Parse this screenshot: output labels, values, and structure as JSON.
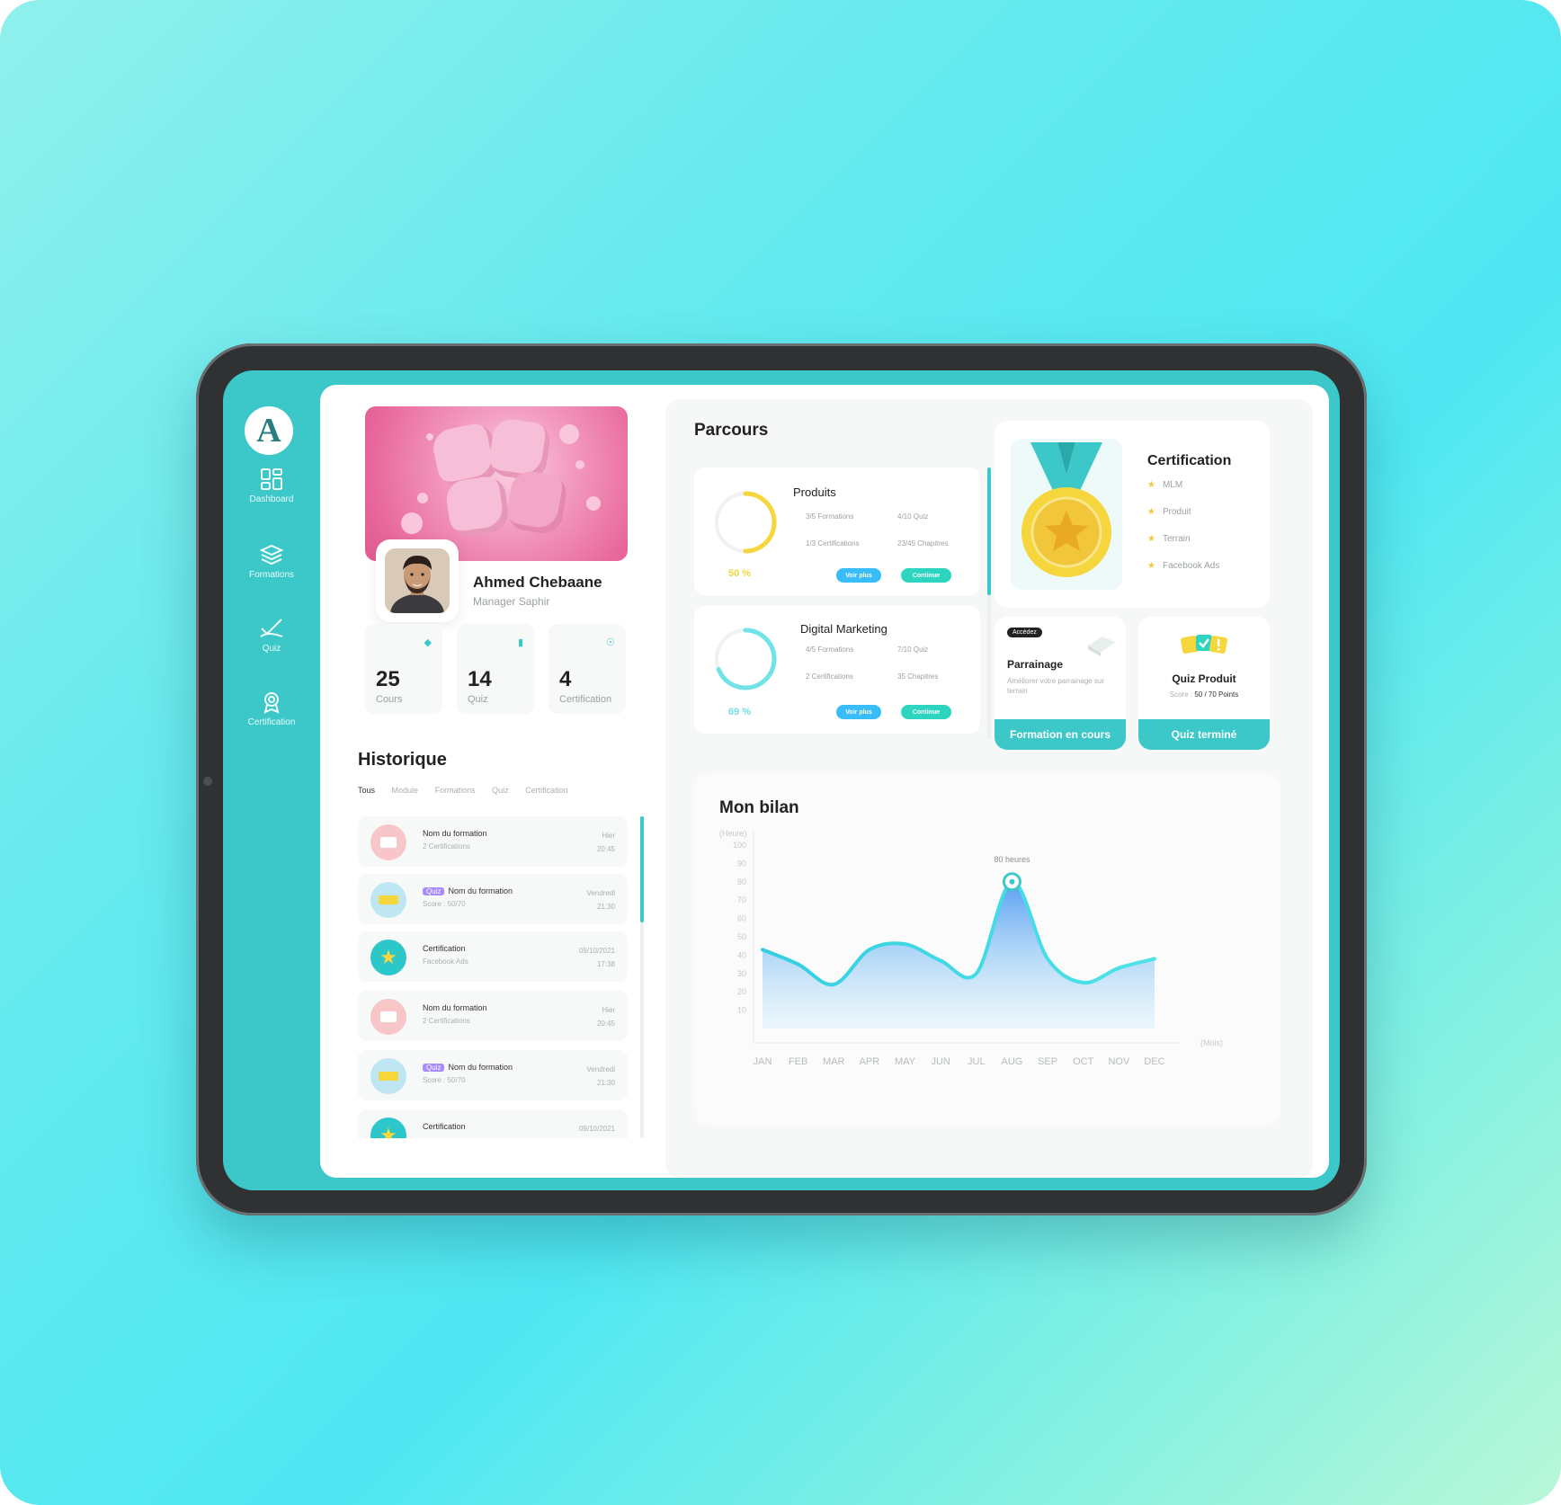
{
  "app": {
    "logo_letter": "A"
  },
  "sidebar": {
    "items": [
      {
        "label": "Dashboard",
        "icon": "dashboard-icon"
      },
      {
        "label": "Formations",
        "icon": "layers-icon"
      },
      {
        "label": "Quiz",
        "icon": "quiz-icon"
      },
      {
        "label": "Certification",
        "icon": "award-icon"
      }
    ]
  },
  "profile": {
    "name": "Ahmed Chebaane",
    "role": "Manager Saphir"
  },
  "stats": [
    {
      "value": "25",
      "label": "Cours",
      "icon": "book-icon"
    },
    {
      "value": "14",
      "label": "Quiz",
      "icon": "chat-icon"
    },
    {
      "value": "4",
      "label": "Certification",
      "icon": "award-icon"
    }
  ],
  "history": {
    "title": "Historique",
    "tabs": [
      "Tous",
      "Module",
      "Formations",
      "Quiz",
      "Certification"
    ],
    "items": [
      {
        "kind": "formation",
        "title": "Nom du formation",
        "sub": "2 Certifications",
        "date": "Hier",
        "time": "20:45"
      },
      {
        "kind": "quiz",
        "tag": "Quiz",
        "title": "Nom du formation",
        "sub": "Score : 50/70",
        "date": "Vendredi",
        "time": "21:30"
      },
      {
        "kind": "certification",
        "title": "Certification",
        "sub": "Facebook Ads",
        "date": "09/10/2021",
        "time": "17:38"
      },
      {
        "kind": "formation",
        "title": "Nom du formation",
        "sub": "2 Certifications",
        "date": "Hier",
        "time": "20:45"
      },
      {
        "kind": "quiz",
        "tag": "Quiz",
        "title": "Nom du formation",
        "sub": "Score : 50/70",
        "date": "Vendredi",
        "time": "21:30"
      },
      {
        "kind": "certification",
        "title": "Certification",
        "sub": "",
        "date": "09/10/2021",
        "time": ""
      }
    ]
  },
  "parcours": {
    "title": "Parcours",
    "courses": [
      {
        "name": "Produits",
        "progress": 0.5,
        "percent_label": "50 %",
        "color": "#f5d63d",
        "meta": [
          "3/5 Formations",
          "4/10 Quiz",
          "1/3 Certifications",
          "23/45 Chapitres"
        ],
        "btn_more": "Voir plus",
        "btn_continue": "Continue"
      },
      {
        "name": "Digital Marketing",
        "progress": 0.69,
        "percent_label": "69 %",
        "color": "#6fe3e8",
        "meta": [
          "4/5 Formations",
          "7/10 Quiz",
          "2 Certifications",
          "35 Chapitres"
        ],
        "btn_more": "Voir plus",
        "btn_continue": "Continue"
      }
    ]
  },
  "certification": {
    "title": "Certification",
    "items": [
      "MLM",
      "Produit",
      "Terrain",
      "Facebook Ads"
    ]
  },
  "parrainage": {
    "badge": "Accédez",
    "title": "Parrainage",
    "desc": "Améliorer votre parrainage sur terrain",
    "button": "Formation en cours"
  },
  "quiz_produit": {
    "title": "Quiz Produit",
    "score_label": "Score :",
    "score_value": "50 / 70 Points",
    "button": "Quiz terminé"
  },
  "colors": {
    "accent": "#3cc8c9",
    "blue_pill": "#38bdf8",
    "green_pill": "#2dd4bf",
    "star": "#f6c640"
  },
  "chart_data": {
    "type": "area",
    "title": "Mon bilan",
    "ylabel": "(Heure)",
    "xlabel": "(Mois)",
    "categories": [
      "JAN",
      "FEB",
      "MAR",
      "APR",
      "MAY",
      "JUN",
      "JUL",
      "AUG",
      "SEP",
      "OCT",
      "NOV",
      "DEC"
    ],
    "values": [
      43,
      35,
      24,
      43,
      46,
      37,
      30,
      80,
      38,
      25,
      33,
      38
    ],
    "ylim": [
      0,
      100
    ],
    "yticks": [
      "100",
      "90",
      "80",
      "70",
      "60",
      "50",
      "40",
      "30",
      "20",
      "10"
    ],
    "annotation": {
      "category": "AUG",
      "label": "80 heures"
    },
    "grid": false
  }
}
